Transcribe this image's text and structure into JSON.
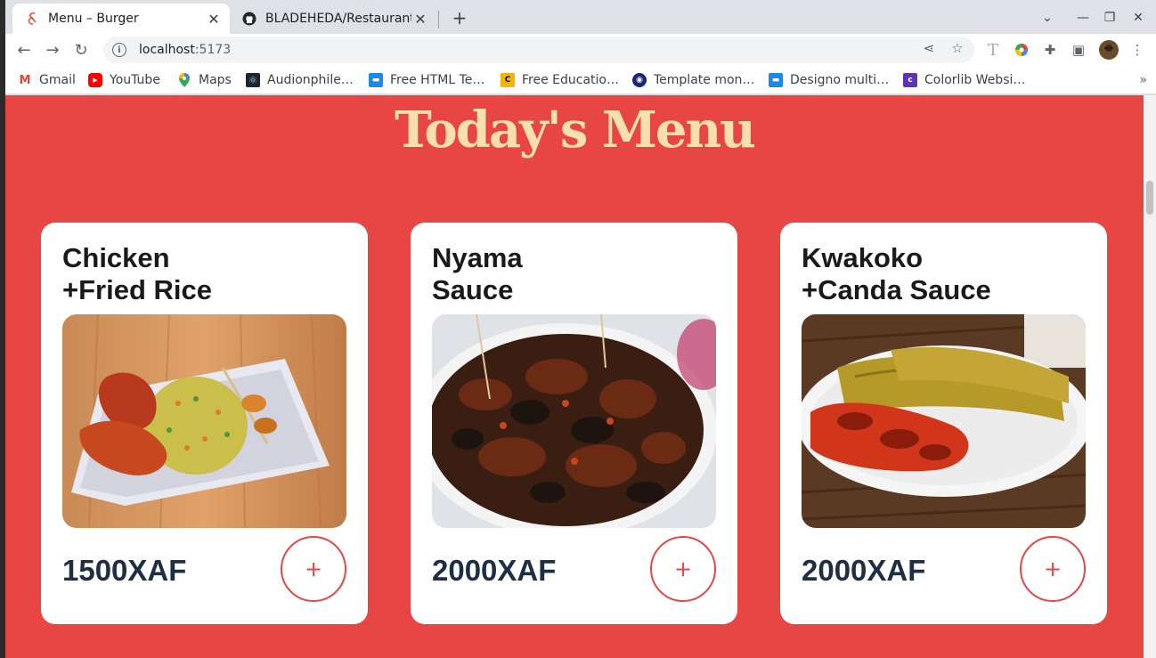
{
  "browser": {
    "tabs": [
      {
        "title": "Menu – Burger",
        "active": true
      },
      {
        "title": "BLADEHEDA/Restaurant-",
        "active": false
      }
    ],
    "url_host": "localhost",
    "url_port": ":5173"
  },
  "bookmarks": [
    {
      "label": "Gmail",
      "icon": "gmail-icon",
      "color": "#ea4335",
      "glyph": "M"
    },
    {
      "label": "YouTube",
      "icon": "youtube-icon",
      "color": "#ff0000",
      "glyph": "▶"
    },
    {
      "label": "Maps",
      "icon": "maps-pin-icon",
      "color": "#34a853",
      "glyph": "●"
    },
    {
      "label": "Audionphile…",
      "icon": "react-icon",
      "color": "#20232a",
      "glyph": "⚛"
    },
    {
      "label": "Free HTML Te…",
      "icon": "site-icon",
      "color": "#1e88e5",
      "glyph": "▬"
    },
    {
      "label": "Free Educatio…",
      "icon": "site-c-icon",
      "color": "#f4b400",
      "glyph": "C"
    },
    {
      "label": "Template mon…",
      "icon": "template-icon",
      "color": "#1a237e",
      "glyph": "◉"
    },
    {
      "label": "Designo multi…",
      "icon": "site-icon",
      "color": "#1e88e5",
      "glyph": "▬"
    },
    {
      "label": "Colorlib Websi…",
      "icon": "colorlib-icon",
      "color": "#5e35b1",
      "glyph": "c"
    }
  ],
  "page": {
    "heading": "Today's Menu",
    "accent": "#e84545",
    "heading_color": "#f7dfb0",
    "items": [
      {
        "name": "Chicken\n+Fried Rice",
        "price": "1500XAF",
        "add_label": "+"
      },
      {
        "name": "Nyama\nSauce",
        "price": "2000XAF",
        "add_label": "+"
      },
      {
        "name": "Kwakoko\n+Canda Sauce",
        "price": "2000XAF",
        "add_label": "+"
      }
    ]
  }
}
